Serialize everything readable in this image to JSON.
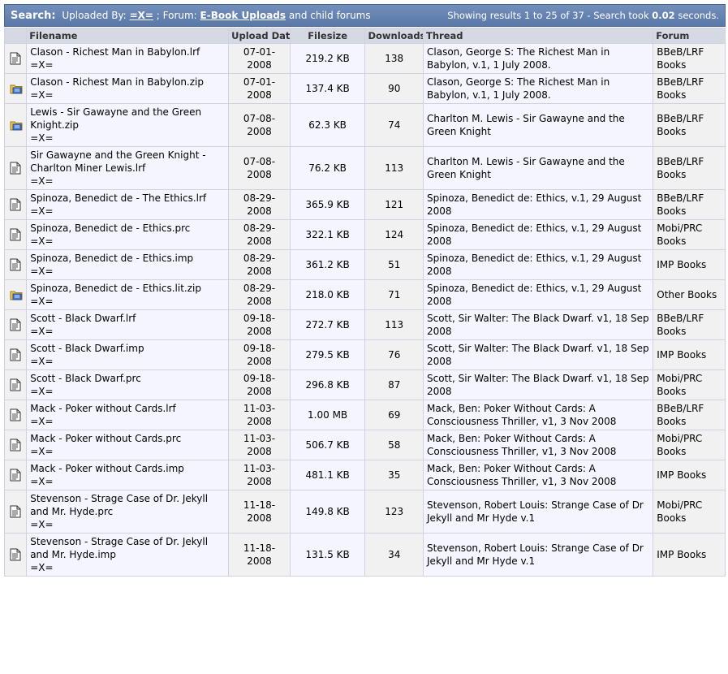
{
  "header": {
    "search_label": "Search:",
    "uploaded_by_label": "Uploaded By:",
    "uploader": "=X=",
    "forum_label": "; Forum:",
    "forum": "E-Book Uploads",
    "child_forums": "and child forums",
    "results_prefix": "Showing results 1 to 25 of 37 - Search took",
    "search_time": "0.02",
    "results_suffix": "seconds."
  },
  "columns": {
    "filename": "Filename",
    "upload_date": "Upload Date",
    "filesize": "Filesize",
    "downloads": "Downloads",
    "thread": "Thread",
    "forum": "Forum"
  },
  "rows": [
    {
      "icon": "document-icon",
      "filename": "Clason - Richest Man in Babylon.lrf",
      "uploader": "=X=",
      "date": "07-01-2008",
      "size": "219.2 KB",
      "downloads": "138",
      "thread": "Clason, George S: The Richest Man in Babylon, v.1, 1 July 2008.",
      "forum": "BBeB/LRF Books"
    },
    {
      "icon": "zip-folder-icon",
      "filename": "Clason - Richest Man in Babylon.zip",
      "uploader": "=X=",
      "date": "07-01-2008",
      "size": "137.4 KB",
      "downloads": "90",
      "thread": "Clason, George S: The Richest Man in Babylon, v.1, 1 July 2008.",
      "forum": "BBeB/LRF Books"
    },
    {
      "icon": "zip-folder-icon",
      "filename": "Lewis - Sir Gawayne and the Green Knight.zip",
      "uploader": "=X=",
      "date": "07-08-2008",
      "size": "62.3 KB",
      "downloads": "74",
      "thread": "Charlton M. Lewis - Sir Gawayne and the Green Knight",
      "forum": "BBeB/LRF Books"
    },
    {
      "icon": "document-icon",
      "filename": "Sir Gawayne and the Green Knight - Charlton Miner Lewis.lrf",
      "uploader": "=X=",
      "date": "07-08-2008",
      "size": "76.2 KB",
      "downloads": "113",
      "thread": "Charlton M. Lewis - Sir Gawayne and the Green Knight",
      "forum": "BBeB/LRF Books"
    },
    {
      "icon": "document-icon",
      "filename": "Spinoza, Benedict de - The Ethics.lrf",
      "uploader": "=X=",
      "date": "08-29-2008",
      "size": "365.9 KB",
      "downloads": "121",
      "thread": "Spinoza, Benedict de: Ethics, v.1, 29 August 2008",
      "forum": "BBeB/LRF Books"
    },
    {
      "icon": "document-icon",
      "filename": "Spinoza, Benedict de - Ethics.prc",
      "uploader": "=X=",
      "date": "08-29-2008",
      "size": "322.1 KB",
      "downloads": "124",
      "thread": "Spinoza, Benedict de: Ethics, v.1, 29 August 2008",
      "forum": "Mobi/PRC Books"
    },
    {
      "icon": "document-icon",
      "filename": "Spinoza, Benedict de - Ethics.imp",
      "uploader": "=X=",
      "date": "08-29-2008",
      "size": "361.2 KB",
      "downloads": "51",
      "thread": "Spinoza, Benedict de: Ethics, v.1, 29 August 2008",
      "forum": "IMP Books"
    },
    {
      "icon": "zip-folder-icon",
      "filename": "Spinoza, Benedict de - Ethics.lit.zip",
      "uploader": "=X=",
      "date": "08-29-2008",
      "size": "218.0 KB",
      "downloads": "71",
      "thread": "Spinoza, Benedict de: Ethics, v.1, 29 August 2008",
      "forum": "Other Books"
    },
    {
      "icon": "document-icon",
      "filename": "Scott - Black Dwarf.lrf",
      "uploader": "=X=",
      "date": "09-18-2008",
      "size": "272.7 KB",
      "downloads": "113",
      "thread": "Scott, Sir Walter: The Black Dwarf. v1, 18 Sep 2008",
      "forum": "BBeB/LRF Books"
    },
    {
      "icon": "document-icon",
      "filename": "Scott - Black Dwarf.imp",
      "uploader": "=X=",
      "date": "09-18-2008",
      "size": "279.5 KB",
      "downloads": "76",
      "thread": "Scott, Sir Walter: The Black Dwarf. v1, 18 Sep 2008",
      "forum": "IMP Books"
    },
    {
      "icon": "document-icon",
      "filename": "Scott - Black Dwarf.prc",
      "uploader": "=X=",
      "date": "09-18-2008",
      "size": "296.8 KB",
      "downloads": "87",
      "thread": "Scott, Sir Walter: The Black Dwarf. v1, 18 Sep 2008",
      "forum": "Mobi/PRC Books"
    },
    {
      "icon": "document-icon",
      "filename": "Mack - Poker without Cards.lrf",
      "uploader": "=X=",
      "date": "11-03-2008",
      "size": "1.00 MB",
      "downloads": "69",
      "thread": "Mack, Ben: Poker Without Cards: A Consciousness Thriller, v1, 3 Nov 2008",
      "forum": "BBeB/LRF Books"
    },
    {
      "icon": "document-icon",
      "filename": "Mack - Poker without Cards.prc",
      "uploader": "=X=",
      "date": "11-03-2008",
      "size": "506.7 KB",
      "downloads": "58",
      "thread": "Mack, Ben: Poker Without Cards: A Consciousness Thriller, v1, 3 Nov 2008",
      "forum": "Mobi/PRC Books"
    },
    {
      "icon": "document-icon",
      "filename": "Mack - Poker without Cards.imp",
      "uploader": "=X=",
      "date": "11-03-2008",
      "size": "481.1 KB",
      "downloads": "35",
      "thread": "Mack, Ben: Poker Without Cards: A Consciousness Thriller, v1, 3 Nov 2008",
      "forum": "IMP Books"
    },
    {
      "icon": "document-icon",
      "filename": "Stevenson - Strage Case of Dr. Jekyll and Mr. Hyde.prc",
      "uploader": "=X=",
      "date": "11-18-2008",
      "size": "149.8 KB",
      "downloads": "123",
      "thread": "Stevenson, Robert Louis: Strange Case of Dr Jekyll and Mr Hyde v.1",
      "forum": "Mobi/PRC Books"
    },
    {
      "icon": "document-icon",
      "filename": "Stevenson - Strage Case of Dr. Jekyll and Mr. Hyde.imp",
      "uploader": "=X=",
      "date": "11-18-2008",
      "size": "131.5 KB",
      "downloads": "34",
      "thread": "Stevenson, Robert Louis: Strange Case of Dr Jekyll and Mr Hyde v.1",
      "forum": "IMP Books"
    }
  ]
}
